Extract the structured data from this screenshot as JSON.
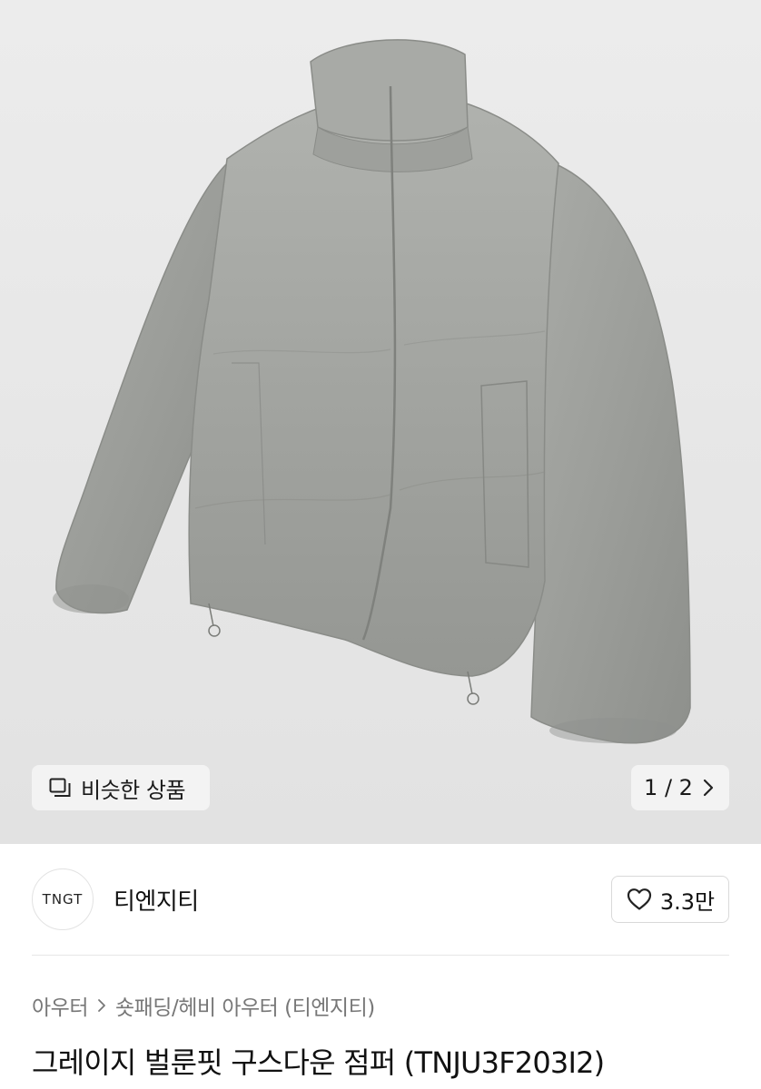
{
  "gallery": {
    "similar_label": "비슷한 상품",
    "pager": "1 / 2",
    "image_alt_icon": "copy-icon"
  },
  "seller": {
    "logo_text": "TNGT",
    "name": "티엔지티",
    "likes": "3.3만"
  },
  "breadcrumb": {
    "items": [
      "아우터",
      "숏패딩/헤비 아우터 (티엔지티)"
    ]
  },
  "product": {
    "title": "그레이지 벌룬핏 구스다운 점퍼 (TNJU3F203I2)"
  },
  "colors": {
    "jacket": "#9a9c98",
    "background": "#e8e8e8"
  }
}
